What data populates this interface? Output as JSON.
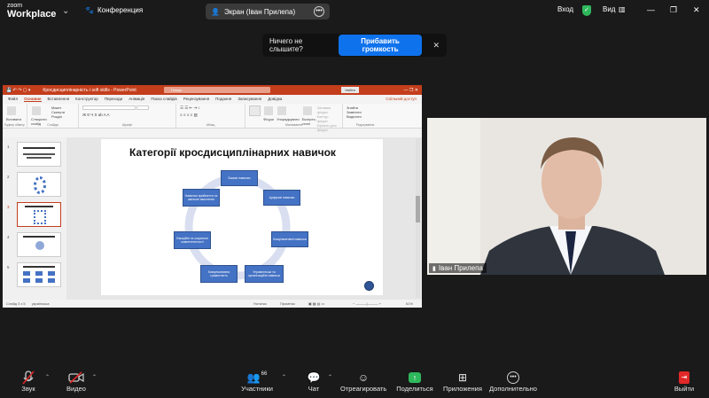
{
  "topbar": {
    "logo_line1": "zoom",
    "logo_line2": "Workplace",
    "conference_label": "Конференция",
    "screen_label": "Экран (Іван Прилепа)",
    "enter_label": "Вход",
    "view_label": "Вид"
  },
  "notice": {
    "text": "Ничего не слышите?",
    "button": "Прибавить громкость"
  },
  "ppt": {
    "file_title": "Кросдисциплінарність і soft skills  -  PowerPoint",
    "search_placeholder": "Пошук",
    "signin": "Увійти",
    "tabs": [
      "Файл",
      "Основне",
      "Вставлення",
      "Конструктор",
      "Переходи",
      "Анімація",
      "Показ слайдів",
      "Рецензування",
      "Подання",
      "Записування",
      "Довідка"
    ],
    "share": "Спільний доступ",
    "ribbon_groups": [
      "Буфер обміну",
      "Слайди",
      "Шрифт",
      "Абзац",
      "Малювання",
      "Редагування"
    ],
    "ribbon_items": {
      "paste": "Вставити",
      "new_slide": "Створити слайд",
      "layout": "Макет",
      "reset": "Скинути",
      "section": "Розділ",
      "shapes": "Фігури",
      "arrange": "Упорядкувати",
      "quick_styles": "Експрес-стилі",
      "fill": "Заливка фігури",
      "outline": "Контур фігури",
      "effects": "Ефекти для фігури",
      "find": "Знайти",
      "replace": "Замінити",
      "select": "Виділити"
    },
    "thumb_numbers": [
      "1",
      "2",
      "3",
      "4",
      "5"
    ],
    "slide_title": "Категорії кросдисциплінарних навичок",
    "nodes": [
      "Базові навички",
      "Цифрові навички",
      "Комунікативні навички",
      "Управлінські та організаційні навички",
      "Комунікативна грамотність",
      "Емоційні та соціальні компетентності",
      "Навички прийняття та шкільне мислення"
    ],
    "status_left": "Слайд 3 з 5",
    "status_lang": "українська",
    "status_notes": "Нотатки",
    "status_comments": "Примітки",
    "zoom": "61%"
  },
  "camera": {
    "participant_name": "Іван Прилепа"
  },
  "toolbar": {
    "sound": "Звук",
    "video": "Видео",
    "participants": "Участники",
    "participants_count": "66",
    "chat": "Чат",
    "record": "Отреагировать",
    "share": "Поделиться",
    "apps": "Приложения",
    "more": "Дополнительно",
    "leave": "Выйти"
  },
  "colors": {
    "powerpoint_accent": "#c43e1c",
    "node_blue": "#4472c4",
    "zoom_blue": "#0e72ed",
    "share_green": "#2eb85c",
    "mute_red": "#e02828"
  }
}
